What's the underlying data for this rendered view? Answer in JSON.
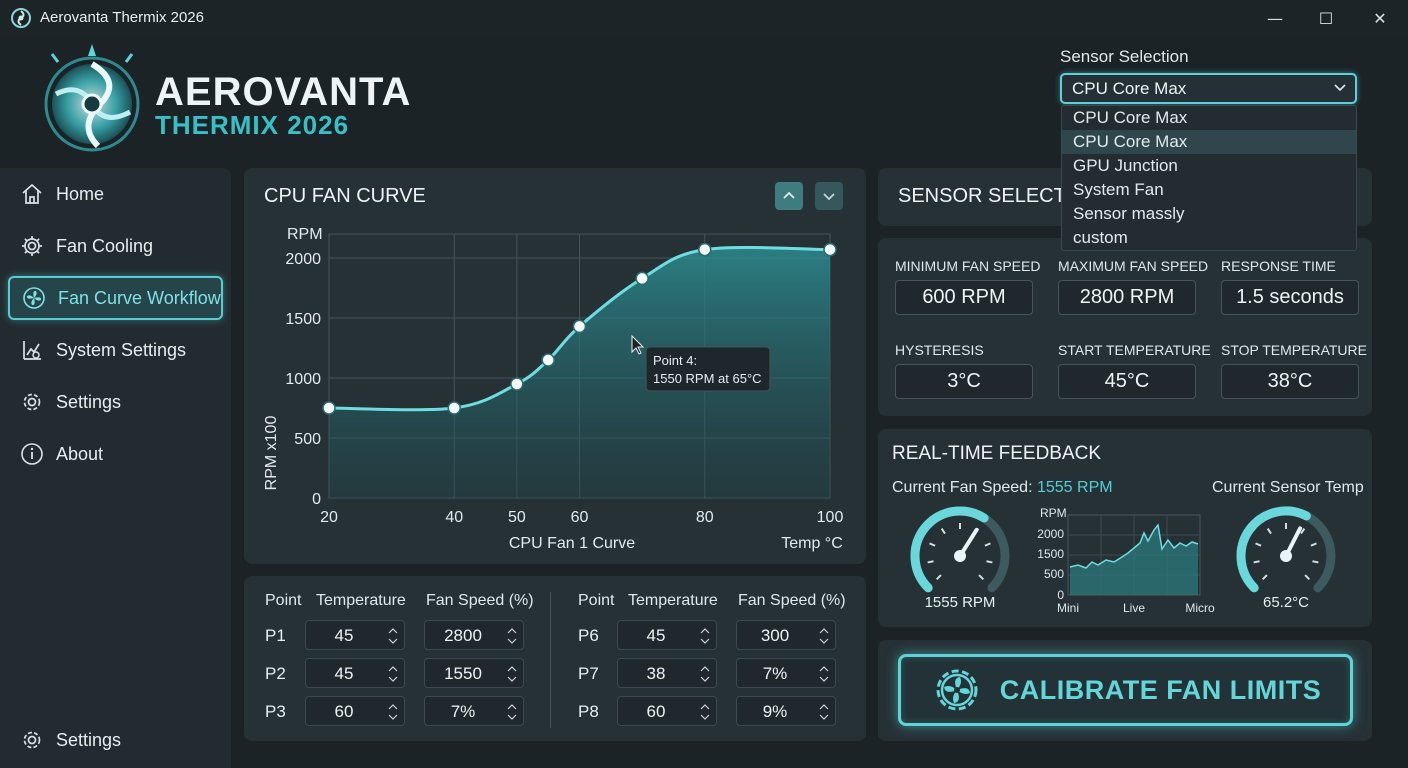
{
  "window": {
    "title": "Aerovanta Thermix 2026",
    "controls": [
      "—",
      "☐",
      "✕"
    ]
  },
  "logo": {
    "line1": "AEROVANTA",
    "line2": "THERMIX 2026"
  },
  "sensor_selection": {
    "label": "Sensor Selection",
    "value": "CPU Core Max",
    "options": [
      "CPU Core Max",
      "CPU Core Max",
      "GPU Junction",
      "System Fan",
      "Sensor massly",
      "custom"
    ],
    "highlighted_index": 1
  },
  "sidebar": {
    "items": [
      {
        "label": "Home",
        "icon": "home-icon"
      },
      {
        "label": "Fan Cooling",
        "icon": "gear-icon"
      },
      {
        "label": "Fan Curve Workflow",
        "icon": "fan-icon",
        "active": true
      },
      {
        "label": "System Settings",
        "icon": "system-settings-icon"
      },
      {
        "label": "Settings",
        "icon": "gear-icon"
      },
      {
        "label": "About",
        "icon": "info-icon"
      }
    ],
    "footer": {
      "label": "Settings",
      "icon": "gear-icon"
    }
  },
  "curve": {
    "title": "CPU FAN CURVE",
    "tooltip": {
      "line1": "Point 4:",
      "line2": "1550 RPM at 65°C"
    }
  },
  "chart_data": {
    "type": "area",
    "x": [
      20,
      40,
      50,
      55,
      60,
      70,
      80,
      100
    ],
    "values": [
      750,
      750,
      950,
      1150,
      1430,
      1830,
      2070,
      2070
    ],
    "xticks": [
      "20",
      "40",
      "50",
      "60",
      "80",
      "100"
    ],
    "xtick_values": [
      20,
      40,
      50,
      60,
      80,
      100
    ],
    "yticks": [
      "0",
      "500",
      "1000",
      "1500",
      "2000"
    ],
    "ytick_values": [
      0,
      500,
      1000,
      1500,
      2000
    ],
    "unit_top": "RPM",
    "ylabel": "RPM x100",
    "xlabel": "CPU Fan 1 Curve",
    "xunit": "Temp °C",
    "xlim": [
      20,
      100
    ],
    "ylim": [
      0,
      2200
    ],
    "grid": true,
    "colors": {
      "line": "#6fdde0",
      "fill": "#2c8c90"
    }
  },
  "points_table": {
    "headers": {
      "point": "Point",
      "temp": "Temperature",
      "speed": "Fan Speed (%)"
    },
    "left": [
      {
        "p": "P1",
        "temp": "45",
        "speed": "2800"
      },
      {
        "p": "P2",
        "temp": "45",
        "speed": "1550"
      },
      {
        "p": "P3",
        "temp": "60",
        "speed": "7%"
      }
    ],
    "right": [
      {
        "p": "P6",
        "temp": "45",
        "speed": "300"
      },
      {
        "p": "P7",
        "temp": "38",
        "speed": "7%"
      },
      {
        "p": "P8",
        "temp": "60",
        "speed": "9%"
      }
    ]
  },
  "sensor_header": {
    "title": "SENSOR SELECTIO"
  },
  "params": [
    {
      "label": "MINIMUM FAN SPEED",
      "value": "600 RPM"
    },
    {
      "label": "MAXIMUM FAN SPEED",
      "value": "2800 RPM"
    },
    {
      "label": "RESPONSE TIME",
      "value": "1.5 seconds"
    },
    {
      "label": "HYSTERESIS",
      "value": "3°C"
    },
    {
      "label": "START TEMPERATURE",
      "value": "45°C"
    },
    {
      "label": "STOP TEMPERATURE",
      "value": "38°C"
    }
  ],
  "feedback": {
    "title": "REAL-TIME FEEDBACK",
    "speed_label": "Current Fan Speed:",
    "speed_value": "1555 RPM",
    "temp_label": "Current Sensor Temp",
    "gauge_left": "1555 RPM",
    "gauge_right": "65.2°C",
    "gauge_left_level": 0.62,
    "gauge_right_level": 0.6,
    "mini_chart": {
      "unit": "RPM",
      "yticks": [
        "2000",
        "1500",
        "500",
        "0"
      ],
      "xticks": [
        "Mini",
        "Live",
        "Micro"
      ]
    }
  },
  "calibrate": {
    "label": "CALIBRATE FAN LIMITS"
  },
  "colors": {
    "accent": "#5ed3d8",
    "background": "#1b2327",
    "panel": "#263136"
  }
}
